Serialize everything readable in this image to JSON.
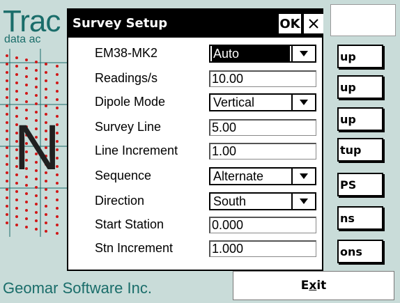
{
  "background": {
    "logo_text": "Trac",
    "logo_subtext": "data ac",
    "big_letter": "N",
    "company": "Geomar Software Inc."
  },
  "side_buttons": [
    {
      "label": "up"
    },
    {
      "label": "up"
    },
    {
      "label": "up"
    },
    {
      "label": "tup"
    },
    {
      "label": "PS"
    },
    {
      "label": "ns"
    },
    {
      "label": "ons"
    }
  ],
  "exit_button": {
    "label": "Exit",
    "mnemonic": "x"
  },
  "dialog": {
    "title": "Survey Setup",
    "ok_label": "OK",
    "close_symbol": "✕",
    "rows": [
      {
        "label": "EM38-MK2",
        "value": "Auto",
        "type": "combo",
        "selected": true
      },
      {
        "label": "Readings/s",
        "value": "10.00",
        "type": "field"
      },
      {
        "label": "Dipole Mode",
        "value": "Vertical",
        "type": "combo"
      },
      {
        "label": "Survey Line",
        "value": "5.00",
        "type": "field"
      },
      {
        "label": "Line Increment",
        "value": "1.00",
        "type": "field"
      },
      {
        "label": "Sequence",
        "value": "Alternate",
        "type": "combo"
      },
      {
        "label": "Direction",
        "value": "South",
        "type": "combo"
      },
      {
        "label": "Start Station",
        "value": "0.000",
        "type": "field"
      },
      {
        "label": "Stn Increment",
        "value": "1.000",
        "type": "field"
      }
    ]
  },
  "colors": {
    "accent_teal": "#1a6d6a",
    "screen_bg": "#c9dcd9",
    "graph_points": "#d01818",
    "grid": "#1a6d6a"
  },
  "icons": {
    "close": "close-icon",
    "dropdown": "chevron-down-icon"
  }
}
